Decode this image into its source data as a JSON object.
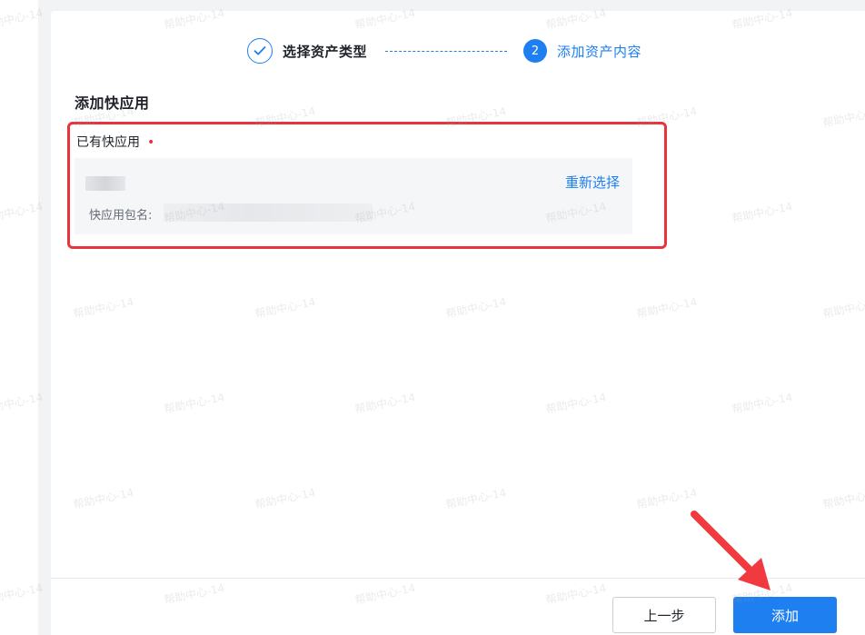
{
  "stepper": {
    "step1_label": "选择资产类型",
    "step2_number": "2",
    "step2_label": "添加资产内容"
  },
  "form": {
    "section_title": "添加快应用",
    "field_label": "已有快应用",
    "required_mark": "•",
    "pkg_label": "快应用包名:",
    "reselect_label": "重新选择"
  },
  "footer": {
    "prev_label": "上一步",
    "add_label": "添加"
  },
  "watermark_text": "帮助中心-14",
  "colors": {
    "primary": "#1d7ff0",
    "highlight": "#e8333d",
    "required": "#e6333a"
  }
}
